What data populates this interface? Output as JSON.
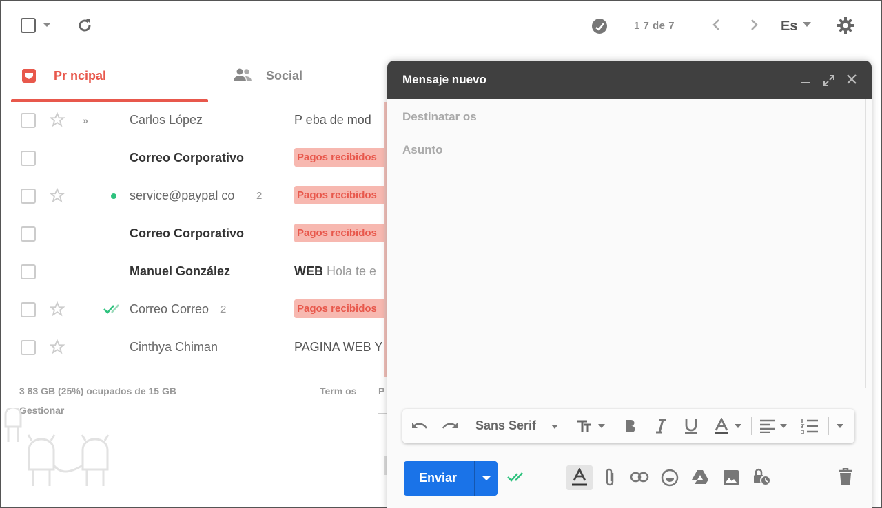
{
  "toolbar": {
    "pagination": "1  7 de 7",
    "language": "Es"
  },
  "tabs": [
    {
      "label": "Pr ncipal",
      "active": true
    },
    {
      "label": "Social",
      "active": false
    }
  ],
  "messages": [
    {
      "sender": "Carlos López",
      "subject": "P   eba de mod",
      "starred": false,
      "important": true,
      "unread": false
    },
    {
      "sender": "Correo Corporativo",
      "label": "Pagos recibidos",
      "unread": true
    },
    {
      "sender": "service@paypal co",
      "count": "2",
      "label": "Pagos recibidos",
      "online": true,
      "unread": false
    },
    {
      "sender": "Correo Corporativo",
      "label": "Pagos recibidos",
      "unread": true
    },
    {
      "sender": "Manuel González",
      "subject_bold": "WEB",
      "snippet": "Hola  te e",
      "unread": true
    },
    {
      "sender": "Correo  Correo",
      "count": "2",
      "label": "Pagos recibidos",
      "sent": true,
      "unread": false
    },
    {
      "sender": "Cinthya Chiman",
      "subject": "PAGINA WEB Y",
      "unread": false
    }
  ],
  "footer": {
    "storage": "3 83 GB (25%) ocupados de 15 GB",
    "manage": "Gestionar",
    "terms": "Term  os",
    "privacy": "P"
  },
  "compose": {
    "title": "Mensaje nuevo",
    "to_placeholder": "Destinatar os",
    "subject_placeholder": "Asunto",
    "font": "Sans Serif",
    "send_label": "Enviar"
  },
  "colors": {
    "accent_red": "#e8584c",
    "label_bg": "#f7b8b0",
    "send_blue": "#1a73e8",
    "compose_header": "#404040",
    "green": "#2ec27e"
  }
}
